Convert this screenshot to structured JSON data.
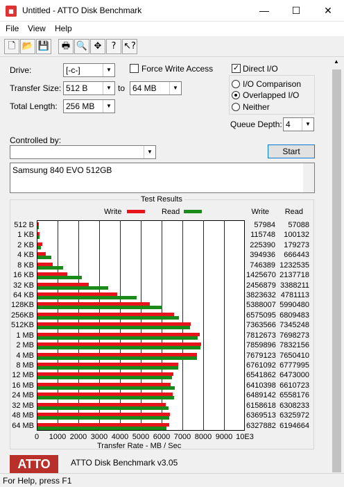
{
  "window": {
    "title": "Untitled - ATTO Disk Benchmark",
    "min": "—",
    "max": "☐",
    "close": "✕"
  },
  "menu": [
    "File",
    "View",
    "Help"
  ],
  "toolbar": [
    {
      "name": "new-icon",
      "glyph": "🗋"
    },
    {
      "name": "open-icon",
      "glyph": "📂"
    },
    {
      "name": "save-icon",
      "glyph": "💾"
    },
    {
      "name": "print-icon",
      "glyph": "🖶"
    },
    {
      "name": "print-preview-icon",
      "glyph": "🔍"
    },
    {
      "name": "move-icon",
      "glyph": "✥"
    },
    {
      "name": "about-icon",
      "glyph": "?"
    },
    {
      "name": "context-help-icon",
      "glyph": "↖?"
    }
  ],
  "form": {
    "drive_label": "Drive:",
    "drive_value": "[-c-]",
    "transfer_size_label": "Transfer Size:",
    "transfer_from": "512 B",
    "to_label": "to",
    "transfer_to": "64 MB",
    "total_length_label": "Total Length:",
    "total_length_value": "256 MB",
    "force_write_label": "Force Write Access",
    "direct_io_label": "Direct I/O",
    "io_comparison_label": "I/O Comparison",
    "overlapped_io_label": "Overlapped I/O",
    "neither_label": "Neither",
    "queue_depth_label": "Queue Depth:",
    "queue_depth_value": "4",
    "controlled_by_label": "Controlled by:",
    "controlled_by_value": "",
    "start_label": "Start",
    "description": "Samsung 840 EVO 512GB"
  },
  "results": {
    "title": "Test Results",
    "write_label": "Write",
    "read_label": "Read",
    "col_write": "Write",
    "col_read": "Read",
    "xlabel": "Transfer Rate - MB / Sec",
    "ticks": [
      "0",
      "1000",
      "2000",
      "3000",
      "4000",
      "5000",
      "6000",
      "7000",
      "8000",
      "9000",
      "10E3"
    ]
  },
  "chart_data": {
    "type": "bar",
    "title": "Test Results",
    "xlabel": "Transfer Rate - MB / Sec",
    "xlim": [
      0,
      10000
    ],
    "categories": [
      "512 B",
      "1 KB",
      "2 KB",
      "4 KB",
      "8 KB",
      "16 KB",
      "32 KB",
      "64 KB",
      "128KB",
      "256KB",
      "512KB",
      "1 MB",
      "2 MB",
      "4 MB",
      "8 MB",
      "12 MB",
      "16 MB",
      "24 MB",
      "32 MB",
      "48 MB",
      "64 MB"
    ],
    "series": [
      {
        "name": "Write",
        "color": "#e8141b",
        "values": [
          57984,
          115748,
          225390,
          394936,
          746389,
          1425670,
          2456879,
          3823632,
          5388007,
          6575095,
          7363566,
          7812673,
          7859896,
          7679123,
          6761092,
          6541862,
          6410398,
          6489142,
          6158618,
          6369513,
          6327882
        ]
      },
      {
        "name": "Read",
        "color": "#1a8a1a",
        "values": [
          57088,
          100132,
          179273,
          666443,
          1232535,
          2137718,
          3388211,
          4781113,
          5990480,
          6809483,
          7345248,
          7698273,
          7832156,
          7650410,
          6777995,
          6473000,
          6610723,
          6558176,
          6308233,
          6325972,
          6194664
        ]
      }
    ]
  },
  "about": {
    "logo": "ATTO",
    "version": "ATTO Disk Benchmark v3.05"
  },
  "status": "For Help, press F1"
}
